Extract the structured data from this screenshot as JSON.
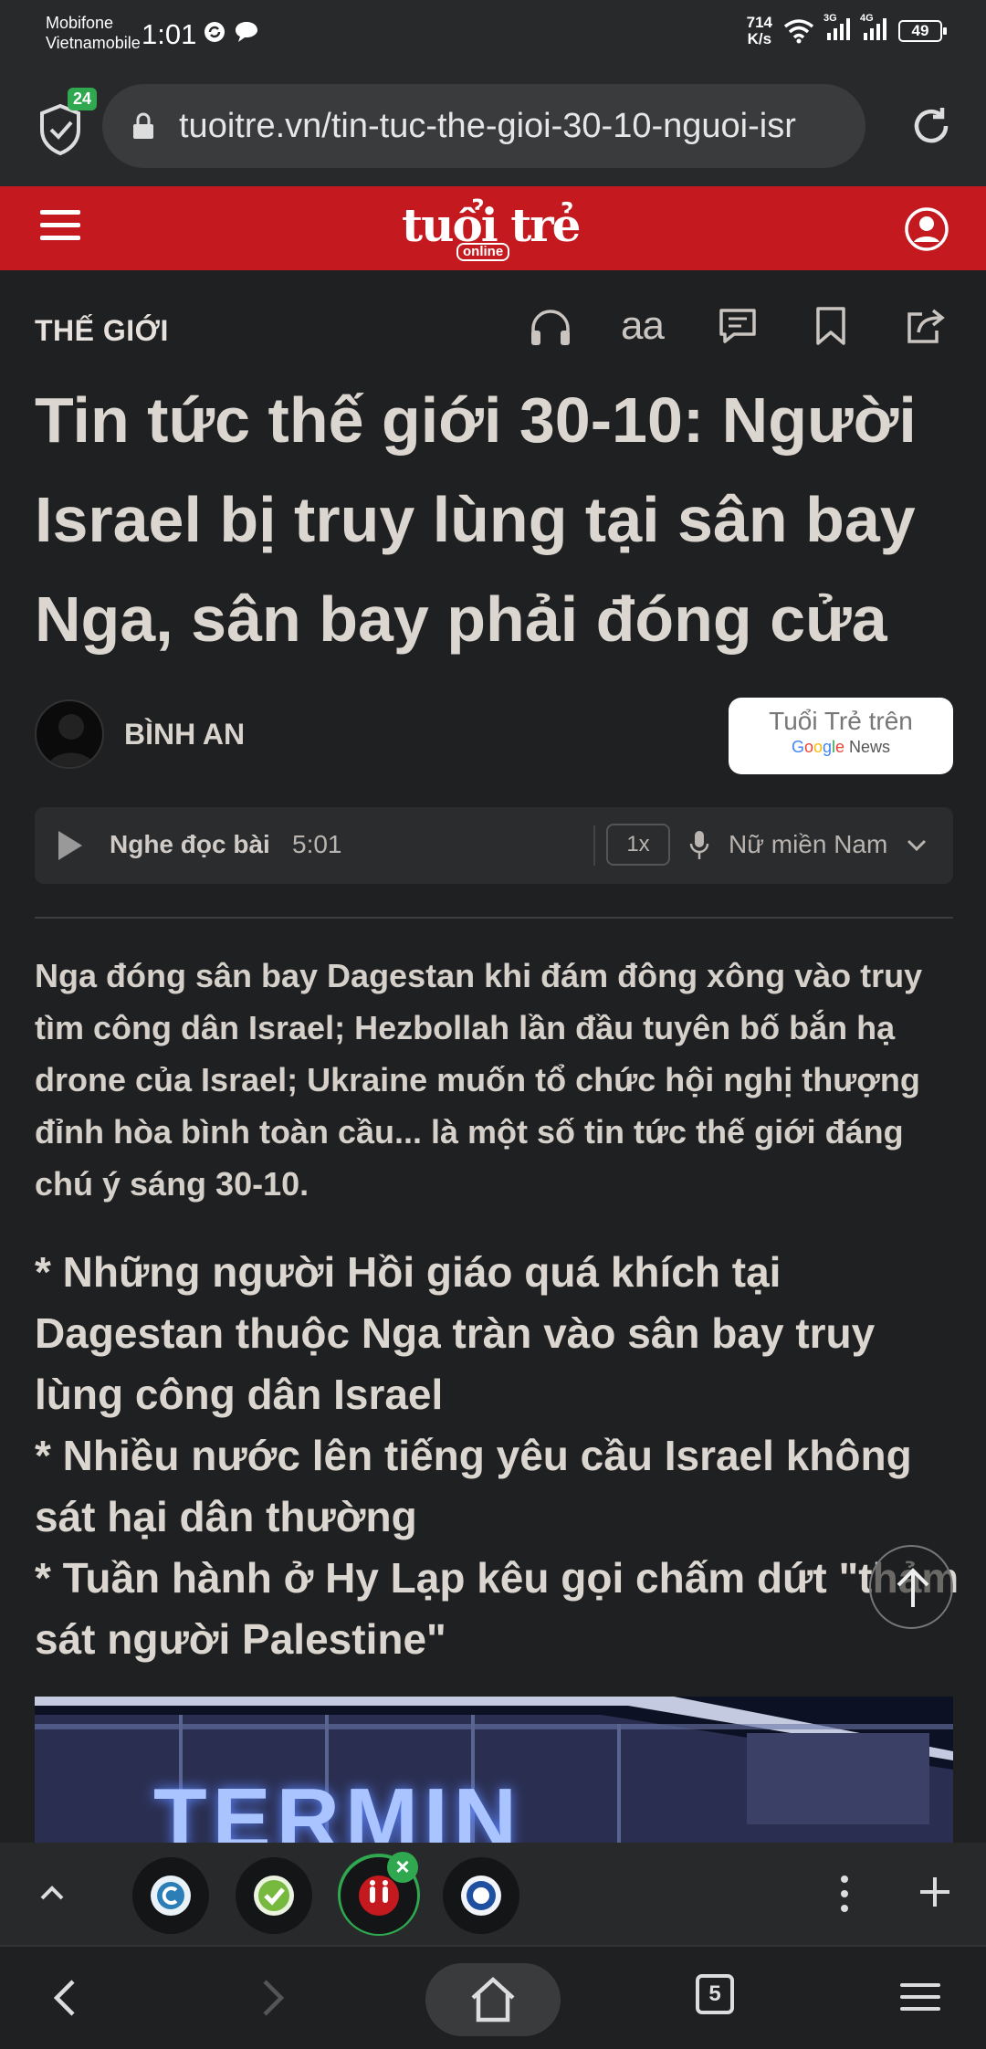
{
  "status_bar": {
    "carrier_line1": "Mobifone",
    "carrier_line2": "Vietnamobile",
    "time": "1:01",
    "net_speed_value": "714",
    "net_speed_unit": "K/s",
    "signal_1_label": "3G",
    "signal_2_label": "4G",
    "battery": "49"
  },
  "browser": {
    "shield_badge": "24",
    "url": "tuoitre.vn/tin-tuc-the-gioi-30-10-nguoi-isr"
  },
  "site_header": {
    "logo_main": "tuổi trẻ",
    "logo_sub": "online"
  },
  "section_bar": {
    "section_name": "THẾ GIỚI",
    "font_size_label": "aa"
  },
  "article": {
    "headline": "Tin tức thế giới 30-10: Người Israel bị truy lùng tại sân bay Nga, sân bay phải đóng cửa",
    "author": "BÌNH AN",
    "gnews_line1": "Tuổi Trẻ trên",
    "gnews_google": [
      "G",
      "o",
      "o",
      "g",
      "l",
      "e"
    ],
    "gnews_news": "News",
    "audio": {
      "label": "Nghe đọc bài",
      "duration": "5:01",
      "speed": "1x",
      "voice": "Nữ miền Nam"
    },
    "sapo": "Nga đóng sân bay Dagestan khi đám đông xông vào truy tìm công dân Israel; Hezbollah lần đầu tuyên bố bắn hạ drone của Israel; Ukraine muốn tổ chức hội nghị thượng đỉnh hòa bình toàn cầu... là một số tin tức thế giới đáng chú ý sáng 30-10.",
    "bullets": [
      "* Những người Hồi giáo quá khích tại Dagestan thuộc Nga tràn vào sân bay truy lùng công dân Israel",
      "* Nhiều nước lên tiếng yêu cầu Israel không sát hại dân thường",
      "* Tuần hành ở Hy Lạp kêu gọi chấm dứt \"thảm sát người Palestine\""
    ],
    "image_text": "TERMIN"
  },
  "tab_bar": {
    "close_symbol": "×"
  },
  "nav_bar": {
    "tab_count": "5"
  },
  "colors": {
    "brand_red": "#c3191f",
    "accent_green": "#2fa84f",
    "background": "#1f2021",
    "chrome": "#28292b"
  }
}
